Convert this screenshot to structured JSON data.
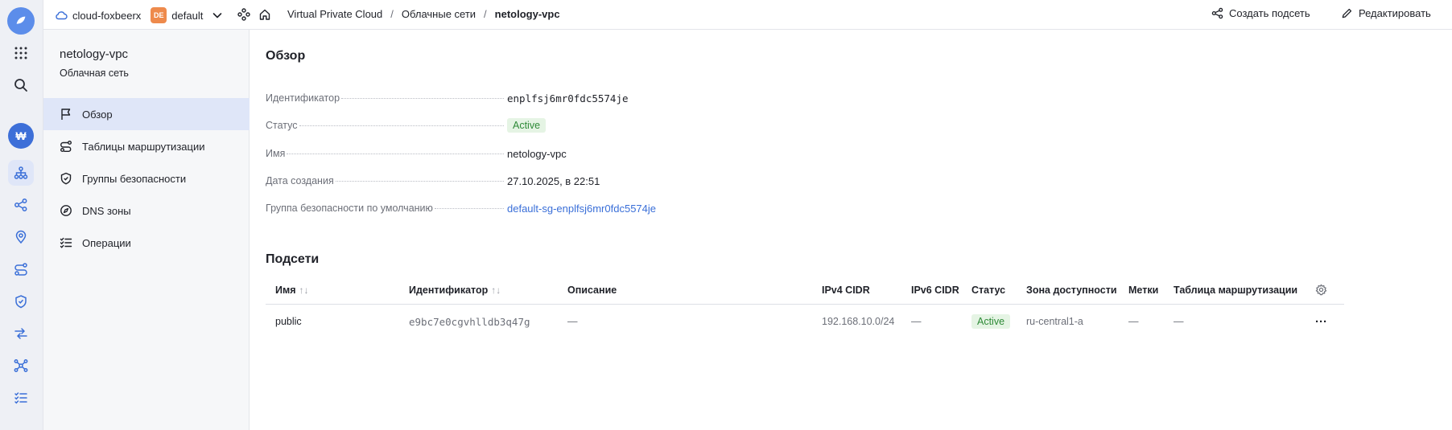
{
  "header": {
    "cloud_name": "cloud-foxbeerx",
    "folder_badge": "DE",
    "folder_name": "default",
    "breadcrumbs": [
      "Virtual Private Cloud",
      "Облачные сети",
      "netology-vpc"
    ],
    "breadcrumb_separator": "/",
    "create_subnet_label": "Создать подсеть",
    "edit_label": "Редактировать"
  },
  "rail": {
    "billing_symbol": "₩",
    "icons": [
      "apps-grid-icon",
      "search-icon",
      "billing-icon",
      "network-icon",
      "share-icon",
      "location-pin-icon",
      "route-icon",
      "shield-check-icon",
      "transfer-icon",
      "nodes-icon",
      "list-check-icon"
    ]
  },
  "sidebar": {
    "title": "netology-vpc",
    "subtitle": "Облачная сеть",
    "items": [
      {
        "label": "Обзор",
        "icon": "flag-icon"
      },
      {
        "label": "Таблицы маршрутизации",
        "icon": "route-icon"
      },
      {
        "label": "Группы безопасности",
        "icon": "shield-icon"
      },
      {
        "label": "DNS зоны",
        "icon": "compass-icon"
      },
      {
        "label": "Операции",
        "icon": "list-check-icon"
      }
    ]
  },
  "overview": {
    "title": "Обзор",
    "rows": [
      {
        "label": "Идентификатор",
        "value": "enplfsj6mr0fdc5574je"
      },
      {
        "label": "Статус",
        "value": "Active"
      },
      {
        "label": "Имя",
        "value": "netology-vpc"
      },
      {
        "label": "Дата создания",
        "value": "27.10.2025, в 22:51"
      },
      {
        "label": "Группа безопасности по умолчанию",
        "value": "default-sg-enplfsj6mr0fdc5574je"
      }
    ]
  },
  "subnets": {
    "title": "Подсети",
    "sort_glyph": "↑↓",
    "columns": [
      "Имя",
      "Идентификатор",
      "Описание",
      "IPv4 CIDR",
      "IPv6 CIDR",
      "Статус",
      "Зона доступности",
      "Метки",
      "Таблица маршрутизации"
    ],
    "rows": [
      {
        "name": "public",
        "id": "e9bc7e0cgvhlldb3q47g",
        "description": "—",
        "ipv4": "192.168.10.0/24",
        "ipv6": "—",
        "status": "Active",
        "zone": "ru-central1-a",
        "labels": "—",
        "route_table": "—"
      }
    ],
    "row_menu": "···"
  },
  "colors": {
    "accent": "#3a6fd8",
    "active_bg": "#e5f4e4",
    "active_text": "#2e8a37",
    "folder_badge": "#ee8a4c"
  }
}
